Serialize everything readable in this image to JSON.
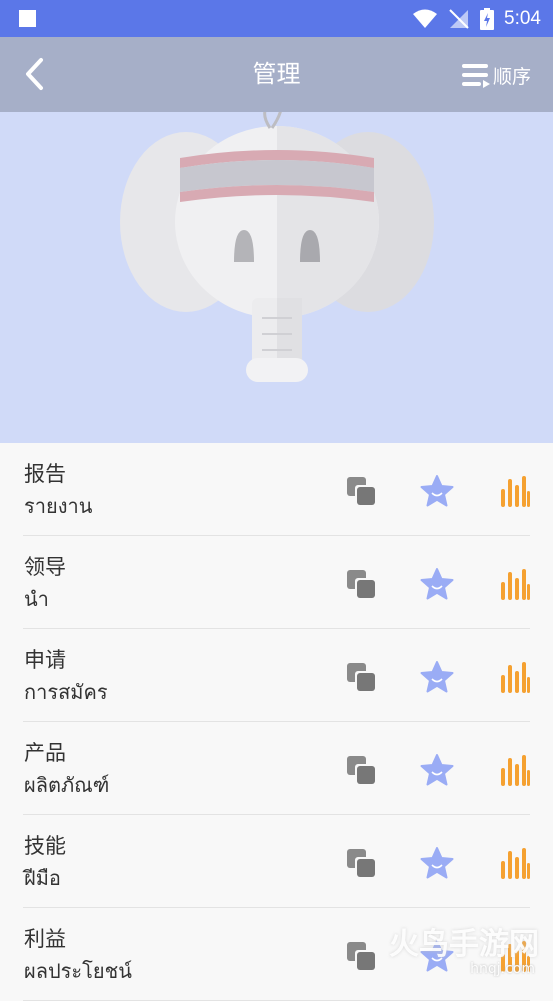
{
  "status_bar": {
    "time": "5:04"
  },
  "app_bar": {
    "title": "管理",
    "order_label": "顺序"
  },
  "colors": {
    "status_bar": "#5b77e8",
    "app_bar": "#a6afc8",
    "hero_bg": "#d0daf8",
    "star": "#9aacf5",
    "audio": "#f5a131",
    "copy": "#7a7a7a"
  },
  "hero": {
    "image": "elephant-mascot-illustration"
  },
  "words": [
    {
      "word": "报告",
      "translation": "รายงาน"
    },
    {
      "word": "领导",
      "translation": "นำ"
    },
    {
      "word": "申请",
      "translation": "การสมัคร"
    },
    {
      "word": "产品",
      "translation": "ผลิตภัณฑ์"
    },
    {
      "word": "技能",
      "translation": "ฝีมือ"
    },
    {
      "word": "利益",
      "translation": "ผลประโยชน์"
    }
  ],
  "watermark": {
    "text": "火鸟手游网",
    "url": "hnqj.com"
  }
}
